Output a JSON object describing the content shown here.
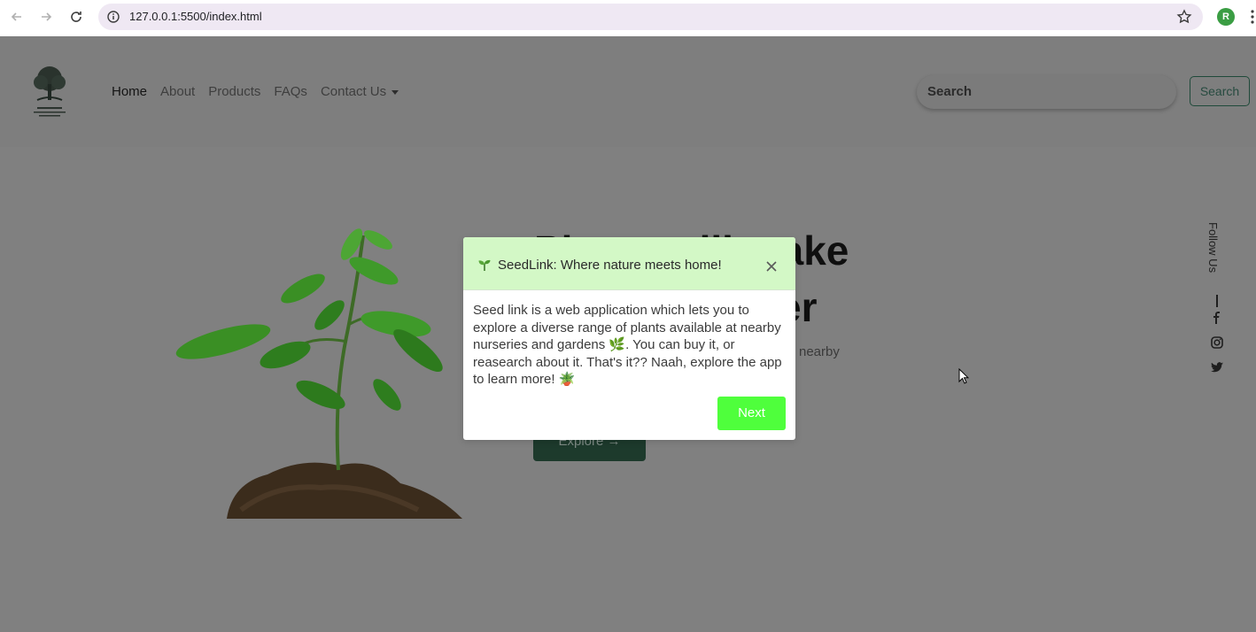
{
  "browser": {
    "url": "127.0.0.1:5500/index.html",
    "profile_initial": "R",
    "icons": [
      "back-icon",
      "forward-icon",
      "reload-icon",
      "site-info-icon",
      "bookmark-star-icon",
      "kebab-menu-icon"
    ]
  },
  "navbar": {
    "links": [
      {
        "label": "Home",
        "active": true
      },
      {
        "label": "About"
      },
      {
        "label": "Products"
      },
      {
        "label": "FAQs"
      },
      {
        "label": "Contact Us"
      }
    ],
    "search_placeholder": "Search",
    "search_button": "Search"
  },
  "hero": {
    "title_line1": "Plants will make",
    "title_line2": "your life better",
    "subtitle_visible": "nearby",
    "explore_button": "Explore →"
  },
  "sidebar": {
    "follow_label": "Follow Us",
    "social_icons": [
      "facebook-icon",
      "instagram-icon",
      "twitter-icon"
    ]
  },
  "modal": {
    "title": "SeedLink: Where nature meets home!",
    "body": "Seed link is a web application which lets you to explore a diverse range of plants available at nearby nurseries and gardens 🌿. You can buy it, or reasearch about it. That's it?? Naah, explore the app to learn more! 🪴",
    "next_button": "Next"
  },
  "colors": {
    "overlay": "#808080",
    "modal_header": "#d3f8c6",
    "next_button": "#4fff3c",
    "explore_button": "#1d3a2c"
  }
}
